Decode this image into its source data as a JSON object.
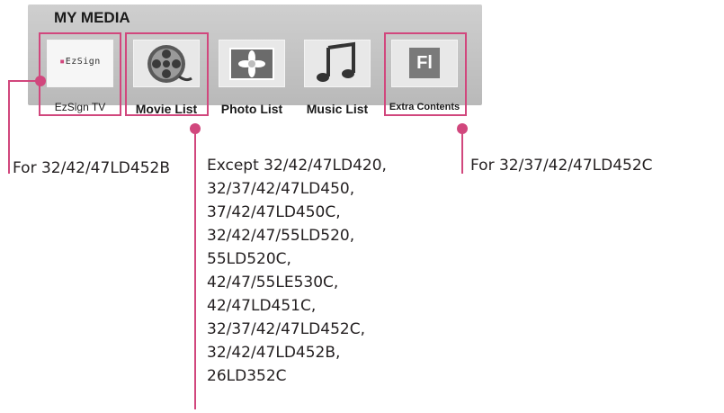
{
  "panel": {
    "title": "MY MEDIA"
  },
  "tiles": [
    {
      "label": "EzSign TV",
      "thumb_text": "EzSign"
    },
    {
      "label": "Movie List"
    },
    {
      "label": "Photo List"
    },
    {
      "label": "Music List"
    },
    {
      "label": "Extra Contents",
      "thumb_text": "Fl"
    }
  ],
  "notes": {
    "ezsign": "For 32/42/47LD452B",
    "extra": "For 32/37/42/47LD452C",
    "movie_lines": [
      "Except 32/42/47LD420,",
      "32/37/42/47LD450,",
      "37/42/47LD450C,",
      "32/42/47/55LD520,",
      "55LD520C,",
      "42/47/55LE530C,",
      "42/47LD451C,",
      "32/37/42/47LD452C,",
      "32/42/47LD452B,",
      "26LD352C"
    ]
  },
  "colors": {
    "accent": "#d1477d",
    "panel": "#c4c4c4"
  }
}
